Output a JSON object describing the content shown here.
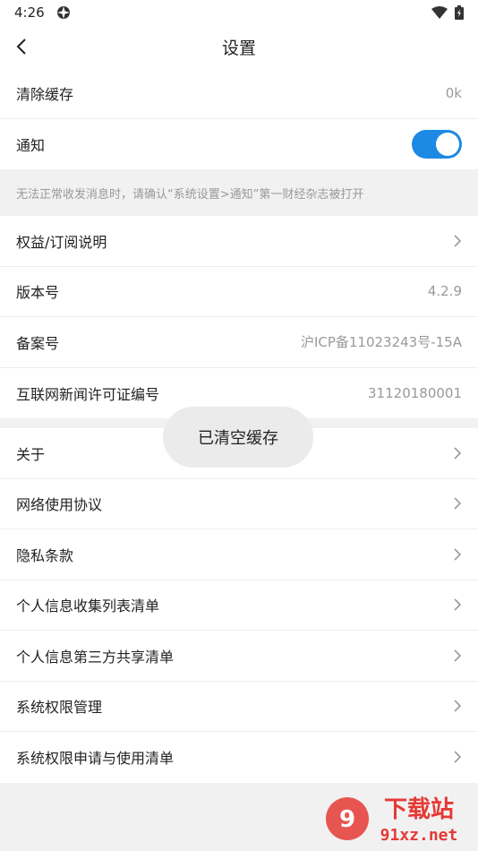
{
  "status_bar": {
    "time": "4:26"
  },
  "header": {
    "title": "设置"
  },
  "group1": [
    {
      "label": "清除缓存",
      "value": "0k"
    },
    {
      "label": "通知",
      "toggle_on": true
    }
  ],
  "note": "无法正常收发消息时，请确认“系统设置>通知”第一财经杂志被打开",
  "group2": [
    {
      "label": "权益/订阅说明"
    },
    {
      "label": "版本号",
      "value": "4.2.9"
    },
    {
      "label": "备案号",
      "value": "沪ICP备11023243号-15A"
    },
    {
      "label": "互联网新闻许可证编号",
      "value": "31120180001"
    }
  ],
  "group3": [
    {
      "label": "关于"
    },
    {
      "label": "网络使用协议"
    },
    {
      "label": "隐私条款"
    },
    {
      "label": "个人信息收集列表清单"
    },
    {
      "label": "个人信息第三方共享清单"
    },
    {
      "label": "系统权限管理"
    },
    {
      "label": "系统权限申请与使用清单"
    }
  ],
  "toast": "已清空缓存",
  "watermark": {
    "line1": "下载站",
    "line2": "91xz.net"
  },
  "colors": {
    "accent": "#1e88e5",
    "watermark": "#e53935"
  }
}
